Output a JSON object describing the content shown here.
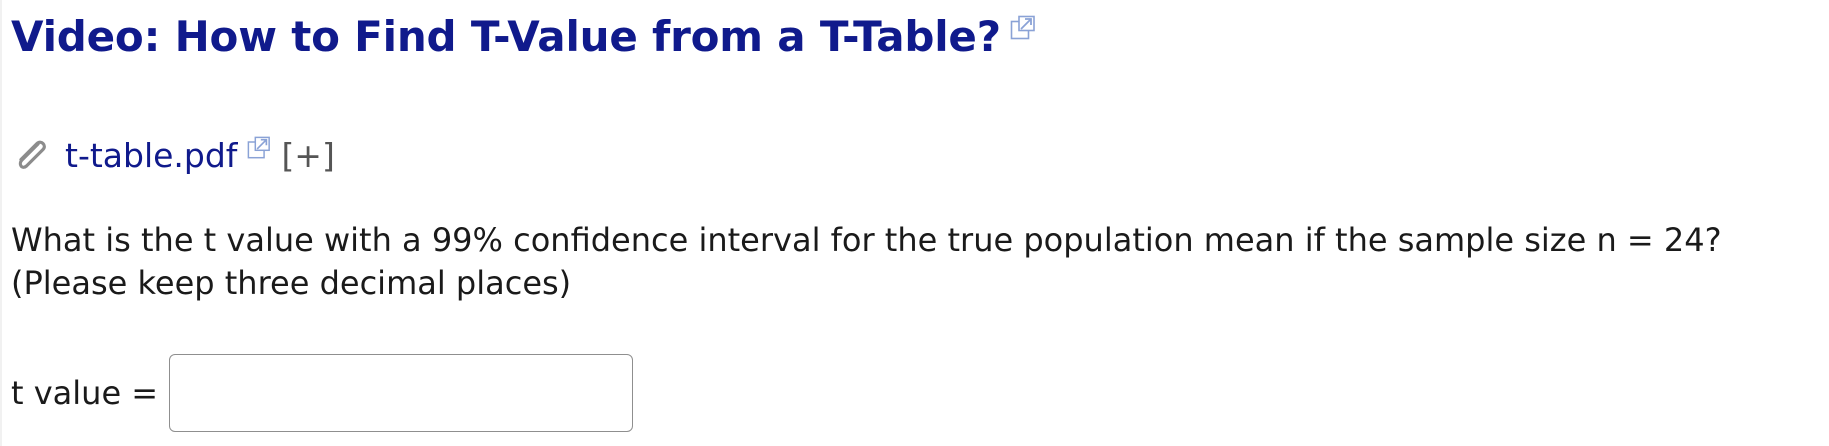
{
  "header": {
    "title": "Video: How to Find T-Value from a T-Table?",
    "title_link_color": "#101a8c",
    "external_icon": "external-link-icon"
  },
  "attachment": {
    "icon": "paperclip-icon",
    "file_name": "t-table.pdf",
    "external_icon": "external-link-icon",
    "expand_label": "[+]"
  },
  "question": {
    "line1": "What is the t value with a 99% confidence interval for the true population mean if the sample size n = 24?",
    "line2": "(Please keep three decimal places)"
  },
  "answer": {
    "label": "t value =",
    "value": "",
    "placeholder": ""
  }
}
